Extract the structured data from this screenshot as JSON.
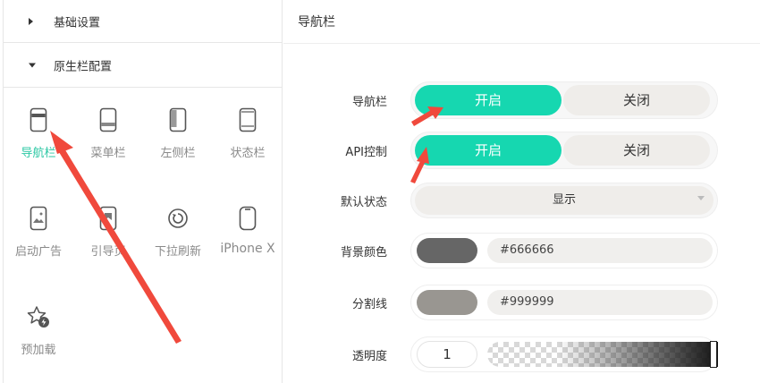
{
  "sidebar": {
    "sections": [
      {
        "label": "基础设置",
        "expanded": false
      },
      {
        "label": "原生栏配置",
        "expanded": true
      }
    ],
    "tiles": [
      {
        "label": "导航栏",
        "icon": "phone-top-bar-icon",
        "active": true
      },
      {
        "label": "菜单栏",
        "icon": "phone-bottom-bar-icon",
        "active": false
      },
      {
        "label": "左侧栏",
        "icon": "phone-left-bar-icon",
        "active": false
      },
      {
        "label": "状态栏",
        "icon": "phone-status-bar-icon",
        "active": false
      },
      {
        "label": "启动广告",
        "icon": "phone-image-icon",
        "active": false
      },
      {
        "label": "引导页",
        "icon": "phone-guide-icon",
        "active": false
      },
      {
        "label": "下拉刷新",
        "icon": "refresh-circle-icon",
        "active": false
      },
      {
        "label": "iPhone X",
        "icon": "iphone-x-icon",
        "active": false
      },
      {
        "label": "预加载",
        "icon": "star-bolt-icon",
        "active": false
      }
    ]
  },
  "main": {
    "title": "导航栏",
    "navbar_toggle": {
      "label": "导航栏",
      "on": "开启",
      "off": "关闭",
      "selected": "开启"
    },
    "api_toggle": {
      "label": "API控制",
      "on": "开启",
      "off": "关闭",
      "selected": "开启"
    },
    "default_state": {
      "label": "默认状态",
      "value": "显示"
    },
    "bg_color": {
      "label": "背景颜色",
      "value": "#666666"
    },
    "divider_color": {
      "label": "分割线",
      "value": "#999999"
    },
    "opacity": {
      "label": "透明度",
      "value": "1"
    }
  },
  "colors": {
    "accent": "#16d7b0",
    "active_label": "#2ec8a5",
    "annotation_arrow": "#f0493c"
  }
}
